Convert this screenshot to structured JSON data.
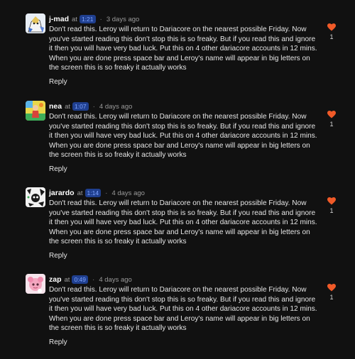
{
  "colors": {
    "background": "#111111",
    "timestamp_bg": "#1f3f8f",
    "timestamp_text": "#7fa4ff",
    "heart": "#f05a28"
  },
  "comments": [
    {
      "username": "j-mad",
      "at": "at",
      "timestamp": "1:21",
      "separator": "·",
      "ago": "3 days ago",
      "text": "Don't read this. Leroy will return to Dariacore on the nearest possible Friday. Now you've started reading this don't stop this is so freaky. But if you read this and ignore it then you will have very bad luck. Put this on 4 other dariacore accounts in 12 mins. When you are done press space bar and Leroy's name will appear in big letters on the screen this is so freaky it actually works",
      "reply_label": "Reply",
      "likes": "1",
      "like_icon": "heart-icon"
    },
    {
      "username": "nea",
      "at": "at",
      "timestamp": "1:07",
      "separator": "·",
      "ago": "4 days ago",
      "text": "Don't read this. Leroy will return to Dariacore on the nearest possible Friday. Now you've started reading this don't stop this is so freaky. But if you read this and ignore it then you will have very bad luck. Put this on 4 other dariacore accounts in 12 mins. When you are done press space bar and Leroy's name will appear in big letters on the screen this is so freaky it actually works",
      "reply_label": "Reply",
      "likes": "1",
      "like_icon": "heart-icon"
    },
    {
      "username": "jarardo",
      "at": "at",
      "timestamp": "1:14",
      "separator": "·",
      "ago": "4 days ago",
      "text": "Don't read this. Leroy will return to Dariacore on the nearest possible Friday. Now you've started reading this don't stop this is so freaky. But if you read this and ignore it then you will have very bad luck. Put this on 4 other dariacore accounts in 12 mins. When you are done press space bar and Leroy's name will appear in big letters on the screen this is so freaky it actually works",
      "reply_label": "Reply",
      "likes": "1",
      "like_icon": "heart-icon"
    },
    {
      "username": "zap",
      "at": "at",
      "timestamp": "0:49",
      "separator": "·",
      "ago": "4 days ago",
      "text": "Don't read this. Leroy will return to Dariacore on the nearest possible Friday. Now you've started reading this don't stop this is so freaky. But if you read this and ignore it then you will have very bad luck. Put this on 4 other dariacore accounts in 12 mins. When you are done press space bar and Leroy's name will appear in big letters on the screen this is so freaky it actually works",
      "reply_label": "Reply",
      "likes": "1",
      "like_icon": "heart-icon"
    }
  ]
}
